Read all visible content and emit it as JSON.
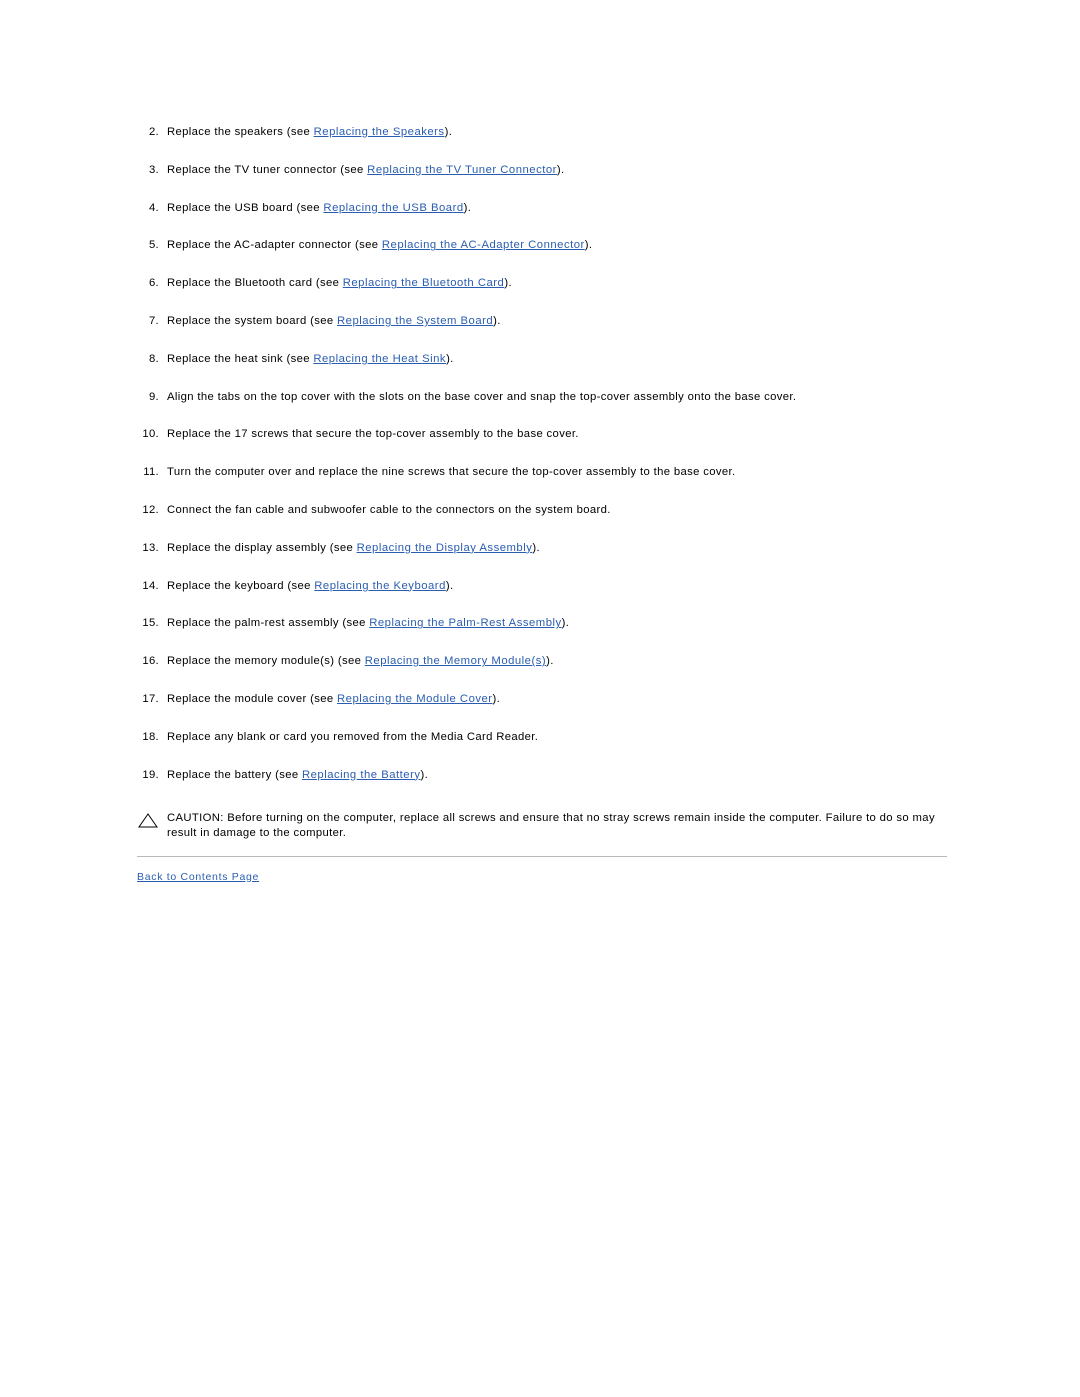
{
  "document": {
    "steps": [
      {
        "num": "2.",
        "pre": "Replace the speakers (see ",
        "link": "Replacing the Speakers",
        "post": ")."
      },
      {
        "num": "3.",
        "pre": "Replace the TV tuner connector (see ",
        "link": "Replacing the TV Tuner Connector",
        "post": ")."
      },
      {
        "num": "4.",
        "pre": "Replace the USB board (see ",
        "link": "Replacing the USB Board",
        "post": ")."
      },
      {
        "num": "5.",
        "pre": "Replace the AC-adapter connector (see ",
        "link": "Replacing the AC-Adapter Connector",
        "post": ")."
      },
      {
        "num": "6.",
        "pre": "Replace the Bluetooth card (see ",
        "link": "Replacing the Bluetooth Card",
        "post": ")."
      },
      {
        "num": "7.",
        "pre": "Replace the system board (see ",
        "link": "Replacing the System Board",
        "post": ")."
      },
      {
        "num": "8.",
        "pre": "Replace the heat sink (see ",
        "link": "Replacing the Heat Sink",
        "post": ")."
      },
      {
        "num": "9.",
        "pre": "Align the tabs on the top cover with the slots on the base cover and snap the top-cover assembly onto the base cover.",
        "link": "",
        "post": ""
      },
      {
        "num": "10.",
        "pre": "Replace the 17 screws that secure the top-cover assembly to the base cover.",
        "link": "",
        "post": ""
      },
      {
        "num": "11.",
        "pre": "Turn the computer over and replace the nine screws that secure the top-cover assembly to the base cover.",
        "link": "",
        "post": ""
      },
      {
        "num": "12.",
        "pre": "Connect the fan cable and subwoofer cable to the connectors on the system board.",
        "link": "",
        "post": ""
      },
      {
        "num": "13.",
        "pre": "Replace the display assembly (see ",
        "link": "Replacing the Display Assembly",
        "post": ")."
      },
      {
        "num": "14.",
        "pre": "Replace the keyboard (see ",
        "link": "Replacing the Keyboard",
        "post": ")."
      },
      {
        "num": "15.",
        "pre": "Replace the palm-rest assembly (see ",
        "link": "Replacing the Palm-Rest Assembly",
        "post": ")."
      },
      {
        "num": "16.",
        "pre": "Replace the memory module(s) (see ",
        "link": "Replacing the Memory Module(s)",
        "post": ")."
      },
      {
        "num": "17.",
        "pre": "Replace the module cover (see ",
        "link": "Replacing the Module Cover",
        "post": ")."
      },
      {
        "num": "18.",
        "pre": "Replace any blank or card you removed from the Media Card Reader.",
        "link": "",
        "post": ""
      },
      {
        "num": "19.",
        "pre": "Replace the battery (see ",
        "link": "Replacing the Battery",
        "post": ")."
      }
    ],
    "caution": {
      "icon": "warning-triangle-icon",
      "text": "CAUTION: Before turning on the computer, replace all screws and ensure that no stray screws remain inside the computer. Failure to do so may result in damage to the computer."
    },
    "back_link": "Back to Contents Page"
  },
  "colors": {
    "link": "#2a5db0",
    "text": "#000000",
    "rule": "#b9b9b9",
    "background": "#ffffff"
  }
}
